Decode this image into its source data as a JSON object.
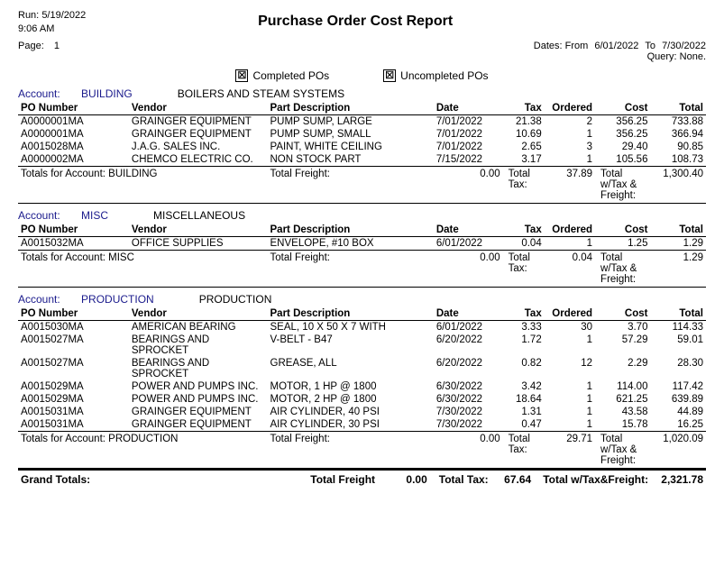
{
  "header": {
    "run_label": "Run:",
    "run_date": "5/19/2022",
    "run_time": "9:06 AM",
    "title": "Purchase Order Cost Report",
    "page_label": "Page:",
    "page_number": "1",
    "dates_label": "Dates: From",
    "dates_from": "6/01/2022",
    "dates_to_label": "To",
    "dates_to": "7/30/2022",
    "query_label": "Query: None."
  },
  "filters": {
    "completed_po_label": "Completed POs",
    "uncompleted_po_label": "Uncompleted POs",
    "completed_checked": true,
    "uncompleted_checked": true
  },
  "accounts": [
    {
      "id": "building",
      "account_label": "Account:",
      "account_code": "BUILDING",
      "account_desc": "BOILERS AND STEAM SYSTEMS",
      "columns": [
        "PO Number",
        "Vendor",
        "Part Description",
        "Date",
        "Tax",
        "Ordered",
        "Cost",
        "Total"
      ],
      "rows": [
        {
          "po": "A0000001MA",
          "vendor": "GRAINGER EQUIPMENT",
          "desc": "PUMP SUMP, LARGE",
          "date": "7/01/2022",
          "tax": "21.38",
          "ordered": "2",
          "cost": "356.25",
          "total": "733.88"
        },
        {
          "po": "A0000001MA",
          "vendor": "GRAINGER EQUIPMENT",
          "desc": "PUMP SUMP, SMALL",
          "date": "7/01/2022",
          "tax": "10.69",
          "ordered": "1",
          "cost": "356.25",
          "total": "366.94"
        },
        {
          "po": "A0015028MA",
          "vendor": "J.A.G. SALES INC.",
          "desc": "PAINT, WHITE CEILING",
          "date": "7/01/2022",
          "tax": "2.65",
          "ordered": "3",
          "cost": "29.40",
          "total": "90.85"
        },
        {
          "po": "A0000002MA",
          "vendor": "CHEMCO ELECTRIC CO.",
          "desc": "NON STOCK PART",
          "date": "7/15/2022",
          "tax": "3.17",
          "ordered": "1",
          "cost": "105.56",
          "total": "108.73"
        }
      ],
      "totals": {
        "label": "Totals for Account: BUILDING",
        "freight_label": "Total Freight:",
        "freight": "0.00",
        "tax_label": "Total Tax:",
        "tax": "37.89",
        "wtf_label": "Total w/Tax & Freight:",
        "wtf": "1,300.40"
      }
    },
    {
      "id": "misc",
      "account_label": "Account:",
      "account_code": "MISC",
      "account_desc": "MISCELLANEOUS",
      "columns": [
        "PO Number",
        "Vendor",
        "Part Description",
        "Date",
        "Tax",
        "Ordered",
        "Cost",
        "Total"
      ],
      "rows": [
        {
          "po": "A0015032MA",
          "vendor": "OFFICE SUPPLIES",
          "desc": "ENVELOPE, #10 BOX",
          "date": "6/01/2022",
          "tax": "0.04",
          "ordered": "1",
          "cost": "1.25",
          "total": "1.29"
        }
      ],
      "totals": {
        "label": "Totals for Account: MISC",
        "freight_label": "Total Freight:",
        "freight": "0.00",
        "tax_label": "Total Tax:",
        "tax": "0.04",
        "wtf_label": "Total w/Tax & Freight:",
        "wtf": "1.29"
      }
    },
    {
      "id": "production",
      "account_label": "Account:",
      "account_code": "PRODUCTION",
      "account_desc": "PRODUCTION",
      "columns": [
        "PO Number",
        "Vendor",
        "Part Description",
        "Date",
        "Tax",
        "Ordered",
        "Cost",
        "Total"
      ],
      "rows": [
        {
          "po": "A0015030MA",
          "vendor": "AMERICAN BEARING",
          "desc": "SEAL, 10 X 50 X 7 WITH",
          "date": "6/01/2022",
          "tax": "3.33",
          "ordered": "30",
          "cost": "3.70",
          "total": "114.33"
        },
        {
          "po": "A0015027MA",
          "vendor": "BEARINGS AND SPROCKET",
          "desc": "V-BELT - B47",
          "date": "6/20/2022",
          "tax": "1.72",
          "ordered": "1",
          "cost": "57.29",
          "total": "59.01"
        },
        {
          "po": "A0015027MA",
          "vendor": "BEARINGS AND SPROCKET",
          "desc": "GREASE,  ALL",
          "date": "6/20/2022",
          "tax": "0.82",
          "ordered": "12",
          "cost": "2.29",
          "total": "28.30"
        },
        {
          "po": "A0015029MA",
          "vendor": "POWER AND PUMPS INC.",
          "desc": "MOTOR, 1 HP @ 1800",
          "date": "6/30/2022",
          "tax": "3.42",
          "ordered": "1",
          "cost": "114.00",
          "total": "117.42"
        },
        {
          "po": "A0015029MA",
          "vendor": "POWER AND PUMPS INC.",
          "desc": "MOTOR, 2 HP @ 1800",
          "date": "6/30/2022",
          "tax": "18.64",
          "ordered": "1",
          "cost": "621.25",
          "total": "639.89"
        },
        {
          "po": "A0015031MA",
          "vendor": "GRAINGER EQUIPMENT",
          "desc": "AIR CYLINDER, 40 PSI",
          "date": "7/30/2022",
          "tax": "1.31",
          "ordered": "1",
          "cost": "43.58",
          "total": "44.89"
        },
        {
          "po": "A0015031MA",
          "vendor": "GRAINGER EQUIPMENT",
          "desc": "AIR CYLINDER, 30 PSI",
          "date": "7/30/2022",
          "tax": "0.47",
          "ordered": "1",
          "cost": "15.78",
          "total": "16.25"
        }
      ],
      "totals": {
        "label": "Totals for Account: PRODUCTION",
        "freight_label": "Total Freight:",
        "freight": "0.00",
        "tax_label": "Total Tax:",
        "tax": "29.71",
        "wtf_label": "Total w/Tax & Freight:",
        "wtf": "1,020.09"
      }
    }
  ],
  "grand_totals": {
    "label": "Grand Totals:",
    "freight_label": "Total Freight",
    "freight": "0.00",
    "tax_label": "Total Tax:",
    "tax": "67.64",
    "wtf_label": "Total w/Tax&Freight:",
    "wtf": "2,321.78"
  }
}
